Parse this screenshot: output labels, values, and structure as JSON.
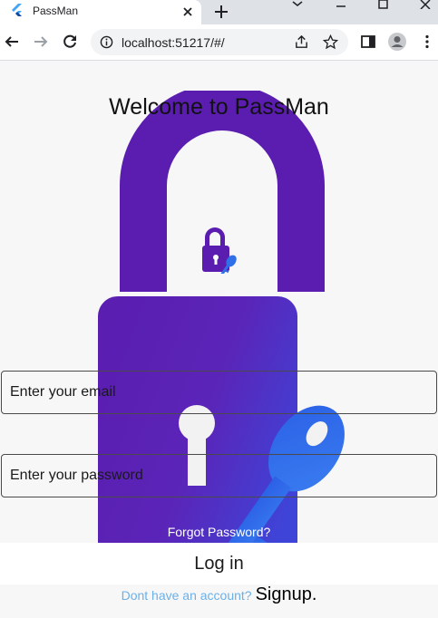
{
  "browser": {
    "tab_title": "PassMan",
    "url": "localhost:51217/#/"
  },
  "page": {
    "title": "Welcome to PassMan",
    "email_placeholder": "Enter your email",
    "password_placeholder": "Enter your password",
    "forgot_password": "Forgot Password?",
    "login_label": "Log in",
    "signup_question": "Dont have an account?",
    "signup_label": "Signup."
  },
  "colors": {
    "lock_dark": "#5b1fb0",
    "lock_key": "#2f6fe8",
    "link_blue": "#6cb0e8"
  },
  "icons": {
    "favicon": "flutter-icon",
    "lock": "padlock-with-key-icon"
  }
}
